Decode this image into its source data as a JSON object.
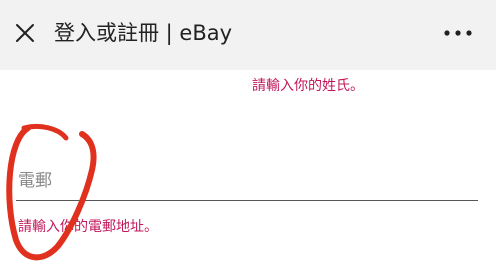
{
  "header": {
    "close_icon": "close-icon",
    "title": "登入或註冊 | eBay",
    "more_icon": "more-horizontal-icon"
  },
  "form": {
    "surname_error": "請輸入你的姓氏。",
    "email": {
      "label": "電郵",
      "value": "",
      "error": "請輸入你的電郵地址。"
    }
  },
  "colors": {
    "header_bg": "#f2f2f2",
    "error": "#c2185b",
    "annotation": "#e0301e"
  }
}
